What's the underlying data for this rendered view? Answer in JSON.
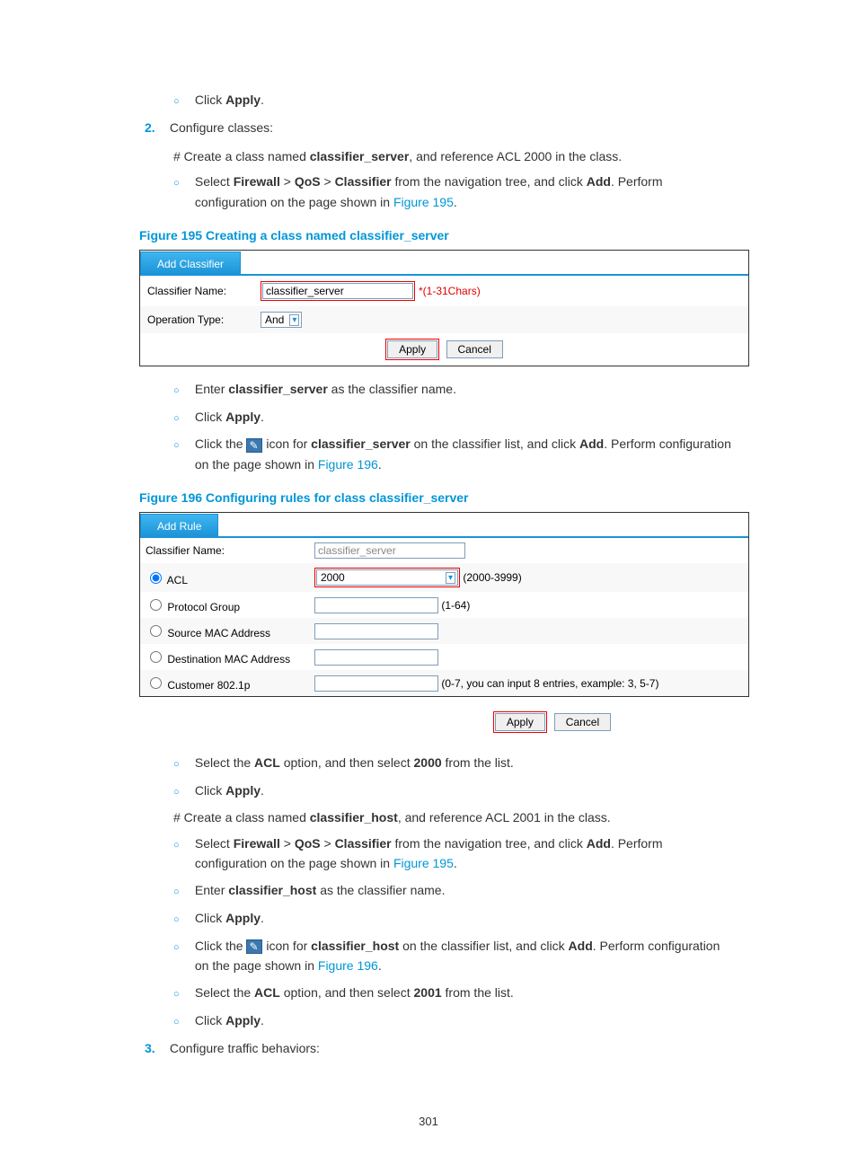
{
  "intro": {
    "click_apply": "Click ",
    "apply_b": "Apply",
    "step2_num": "2.",
    "step2_text": "Configure classes:",
    "sharp1_a": "# Create a class named ",
    "sharp1_b": "classifier_server",
    "sharp1_c": ", and reference ACL 2000 in the class.",
    "nav_a": "Select ",
    "nav_fw": "Firewall",
    "nav_gt1": " > ",
    "nav_qos": "QoS",
    "nav_gt2": " > ",
    "nav_cls": "Classifier",
    "nav_b": " from the navigation tree, and click ",
    "nav_add": "Add",
    "nav_c": ". Perform configuration on the page shown in ",
    "fig195_link": "Figure 195",
    "period": "."
  },
  "fig195": {
    "label": "Figure 195 Creating a class named classifier_server",
    "tab": "Add Classifier",
    "row_name_label": "Classifier Name:",
    "row_name_value": "classifier_server",
    "row_name_hint": "*(1-31Chars)",
    "row_op_label": "Operation Type:",
    "row_op_value": "And",
    "btn_apply": "Apply",
    "btn_cancel": "Cancel"
  },
  "post195": {
    "li1_a": "Enter ",
    "li1_b": "classifier_server",
    "li1_c": " as the classifier name.",
    "li2_a": "Click ",
    "li2_b": "Apply",
    "li3_a": "Click the ",
    "li3_b": " icon for ",
    "li3_c": "classifier_server",
    "li3_d": " on the classifier list, and click ",
    "li3_e": "Add",
    "li3_f": ". Perform configuration on the page shown in ",
    "fig196_link": "Figure 196"
  },
  "fig196": {
    "label": "Figure 196 Configuring rules for class classifier_server",
    "tab": "Add Rule",
    "row_name_label": "Classifier Name:",
    "row_name_value": "classifier_server",
    "r_acl": "ACL",
    "r_acl_val": "2000",
    "r_acl_hint": "(2000-3999)",
    "r_pg": "Protocol Group",
    "r_pg_hint": "(1-64)",
    "r_smac": "Source MAC Address",
    "r_dmac": "Destination MAC Address",
    "r_cust": "Customer 802.1p",
    "r_cust_hint": "(0-7, you can input 8 entries, example: 3, 5-7)",
    "btn_apply": "Apply",
    "btn_cancel": "Cancel"
  },
  "post196": {
    "li1_a": "Select the ",
    "li1_b": "ACL",
    "li1_c": " option, and then select ",
    "li1_d": "2000",
    "li1_e": " from the list.",
    "li2_a": "Click ",
    "li2_b": "Apply",
    "sharp2_a": "# Create a class named ",
    "sharp2_b": "classifier_host",
    "sharp2_c": ", and reference ACL 2001 in the class.",
    "nav_a": "Select ",
    "nav_fw": "Firewall",
    "nav_gt1": " > ",
    "nav_qos": "QoS",
    "nav_gt2": " > ",
    "nav_cls": "Classifier",
    "nav_b": " from the navigation tree, and click ",
    "nav_add": "Add",
    "nav_c": ". Perform configuration on the page shown in ",
    "fig195_link2": "Figure 195",
    "li4_a": "Enter ",
    "li4_b": "classifier_host",
    "li4_c": " as the classifier name.",
    "li5_a": "Click ",
    "li5_b": "Apply",
    "li6_a": "Click the ",
    "li6_b": " icon for ",
    "li6_c": "classifier_host",
    "li6_d": " on the classifier list, and click ",
    "li6_e": "Add",
    "li6_f": ". Perform configuration on the page shown in ",
    "fig196_link2": "Figure 196",
    "li7_a": "Select the ",
    "li7_b": "ACL",
    "li7_c": " option, and then select ",
    "li7_d": "2001",
    "li7_e": " from the list.",
    "li8_a": "Click ",
    "li8_b": "Apply",
    "step3_num": "3.",
    "step3_text": "Configure traffic behaviors:"
  },
  "page_number": "301"
}
